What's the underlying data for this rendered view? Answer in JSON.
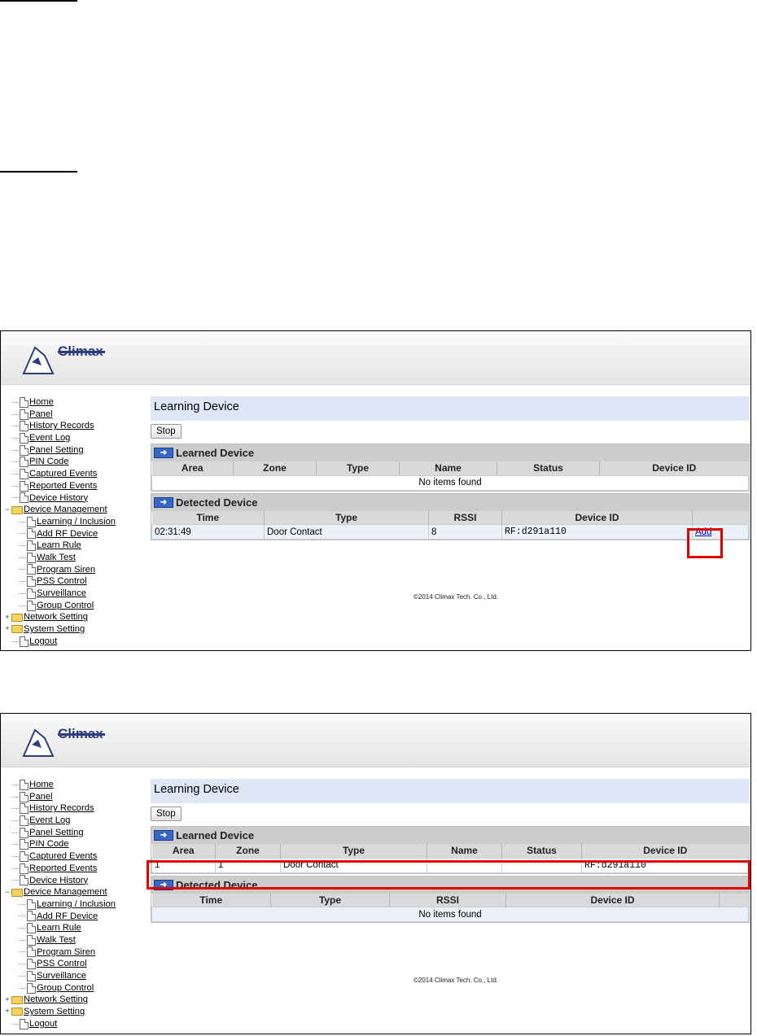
{
  "screens": [
    {
      "brand": "Climax",
      "page_title": "Learning Device",
      "stop_label": "Stop",
      "learned_title": "Learned Device",
      "learned_columns": [
        "Area",
        "Zone",
        "Type",
        "Name",
        "Status",
        "Device ID"
      ],
      "learned_empty": "No items found",
      "detected_title": "Detected Device",
      "detected_columns": [
        "Time",
        "Type",
        "RSSI",
        "Device ID"
      ],
      "detected_row": {
        "time": "02:31:49",
        "type": "Door Contact",
        "rssi": "8",
        "device_id": "RF:d291a110",
        "action": "Add"
      },
      "footer": "©2014 Climax Tech. Co., Ltd."
    },
    {
      "brand": "Climax",
      "page_title": "Learning Device",
      "stop_label": "Stop",
      "learned_title": "Learned Device",
      "learned_columns": [
        "Area",
        "Zone",
        "Type",
        "Name",
        "Status",
        "Device ID"
      ],
      "learned_row": {
        "area": "1",
        "zone": "1",
        "type": "Door Contact",
        "name": "",
        "status": "",
        "device_id": "RF:d291a110"
      },
      "detected_title": "Detected Device",
      "detected_columns": [
        "Time",
        "Type",
        "RSSI",
        "Device ID"
      ],
      "detected_empty": "No items found",
      "footer": "©2014 Climax Tech. Co., Ltd."
    }
  ],
  "sidebar": [
    {
      "label": "Home",
      "kind": "page",
      "level": 0
    },
    {
      "label": "Panel",
      "kind": "page",
      "level": 0
    },
    {
      "label": "History Records",
      "kind": "page",
      "level": 0
    },
    {
      "label": "Event Log",
      "kind": "page",
      "level": 0
    },
    {
      "label": "Panel Setting",
      "kind": "page",
      "level": 0
    },
    {
      "label": "PIN Code",
      "kind": "page",
      "level": 0
    },
    {
      "label": "Captured Events",
      "kind": "page",
      "level": 0
    },
    {
      "label": "Reported Events",
      "kind": "page",
      "level": 0
    },
    {
      "label": "Device History",
      "kind": "page",
      "level": 0
    },
    {
      "label": "Device Management",
      "kind": "folder-open",
      "level": 0
    },
    {
      "label": "Learning / Inclusion",
      "kind": "page",
      "level": 1
    },
    {
      "label": "Add RF Device",
      "kind": "page",
      "level": 1
    },
    {
      "label": "Learn Rule",
      "kind": "page",
      "level": 1
    },
    {
      "label": "Walk Test",
      "kind": "page",
      "level": 1
    },
    {
      "label": "Program Siren",
      "kind": "page",
      "level": 1
    },
    {
      "label": "PSS Control",
      "kind": "page",
      "level": 1
    },
    {
      "label": "Surveillance",
      "kind": "page",
      "level": 1
    },
    {
      "label": "Group Control",
      "kind": "page",
      "level": 1
    },
    {
      "label": "Network Setting",
      "kind": "folder",
      "level": 0
    },
    {
      "label": "System Setting",
      "kind": "folder",
      "level": 0
    },
    {
      "label": "Logout",
      "kind": "page",
      "level": 0
    }
  ],
  "colors": {
    "highlight": "#e00000",
    "title_bar": "#dde7f6",
    "link": "#0000cc"
  }
}
